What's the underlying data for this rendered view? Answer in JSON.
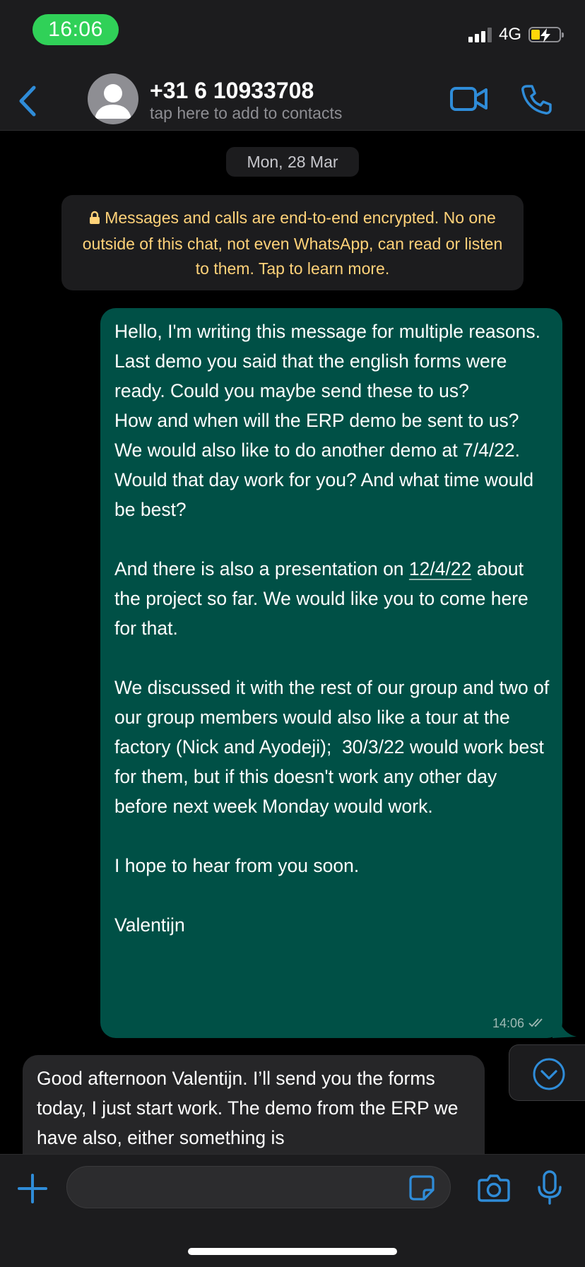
{
  "status_bar": {
    "time": "16:06",
    "network": "4G"
  },
  "header": {
    "contact_name": "+31 6 10933708",
    "contact_subtitle": "tap here to add to contacts",
    "icons": [
      "back-chevron-icon",
      "avatar-icon",
      "video-call-icon",
      "phone-call-icon"
    ],
    "accent_color": "#2f8cd8"
  },
  "chat": {
    "date_label": "Mon, 28 Mar",
    "encryption_notice": "Messages and calls are end-to-end encrypted. No one outside of this chat, not even WhatsApp, can read or listen to them. Tap to learn more.",
    "outgoing_message": {
      "line1": "Hello, I'm writing this message for multiple reasons. Last demo you said that the english forms were ready. Could you maybe send these to us?",
      "line2": "How and when will the ERP demo be sent to us?",
      "line3": "We would also like to do another demo at 7/4/22. Would that day work for you? And what time would be best?",
      "line4_before": "And there is also a presentation on ",
      "line4_link": "12/4/22",
      "line4_after": " about the project so far. We would like you to come here for that.",
      "line5": "We discussed it with the rest of our group and two of our group members would also like a tour at the factory (Nick and Ayodeji);  30/3/22 would work best for them, but if this doesn't work any other day before next week Monday would work.",
      "line6": "I hope to hear from you soon.",
      "line7": "Valentijn",
      "time": "14:06",
      "bubble_color": "#005046"
    },
    "incoming_message": {
      "text": "Good afternoon Valentijn. I’ll send you the forms today, I just start work. The demo from the ERP we have also, either something is",
      "bubble_color": "#262628"
    }
  },
  "composer": {
    "input_value": "",
    "icons": [
      "plus-icon",
      "sticker-icon",
      "camera-icon",
      "microphone-icon"
    ]
  }
}
